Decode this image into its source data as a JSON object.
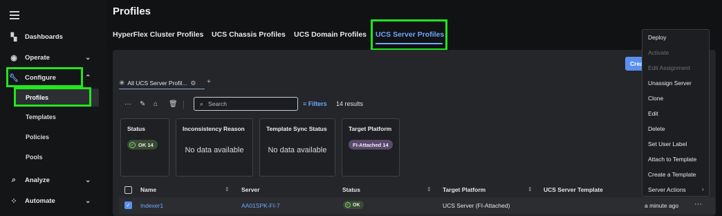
{
  "sidebar": {
    "items": [
      {
        "label": "Dashboards",
        "icon": "dashboard-icon"
      },
      {
        "label": "Operate",
        "icon": "operate-icon"
      },
      {
        "label": "Configure",
        "icon": "wrench-icon"
      },
      {
        "label": "Analyze",
        "icon": "analyze-icon"
      },
      {
        "label": "Automate",
        "icon": "automate-icon"
      }
    ],
    "configure_sub": [
      "Profiles",
      "Templates",
      "Policies",
      "Pools"
    ]
  },
  "page": {
    "title": "Profiles"
  },
  "tabs": [
    "HyperFlex Cluster Profiles",
    "UCS Chassis Profiles",
    "UCS Domain Profiles",
    "UCS Server Profiles"
  ],
  "create_button": "Crea",
  "view_tab": {
    "label": "All UCS Server Profil...",
    "plus": "+"
  },
  "search": {
    "placeholder": "Search"
  },
  "filters_label": "Filters",
  "results": "14 results",
  "cards": {
    "status": {
      "title": "Status",
      "ok": "OK 14"
    },
    "inconsistency": {
      "title": "Inconsistency Reason",
      "empty": "No data available"
    },
    "template_sync": {
      "title": "Template Sync Status",
      "empty": "No data available"
    },
    "platform": {
      "title": "Target Platform",
      "badge": "FI-Attached 14"
    }
  },
  "table": {
    "headers": [
      "Name",
      "Server",
      "Status",
      "Target Platform",
      "UCS Server Template"
    ],
    "row": {
      "name": "Indexer1",
      "server": "AA01SPK-FI-7",
      "status": "OK",
      "platform": "UCS Server (FI-Attached)",
      "modified": "a minute ago",
      "more": "···"
    }
  },
  "dropdown": {
    "items": [
      "Deploy",
      "Activate",
      "Edit Assignment",
      "Unassign Server",
      "Clone",
      "Edit",
      "Delete",
      "Set User Label",
      "Attach to Template",
      "Create a Template",
      "Server Actions"
    ]
  },
  "colors": {
    "accent": "#6fa8ff",
    "highlight": "#22e51e",
    "ok": "#7bd36b"
  }
}
